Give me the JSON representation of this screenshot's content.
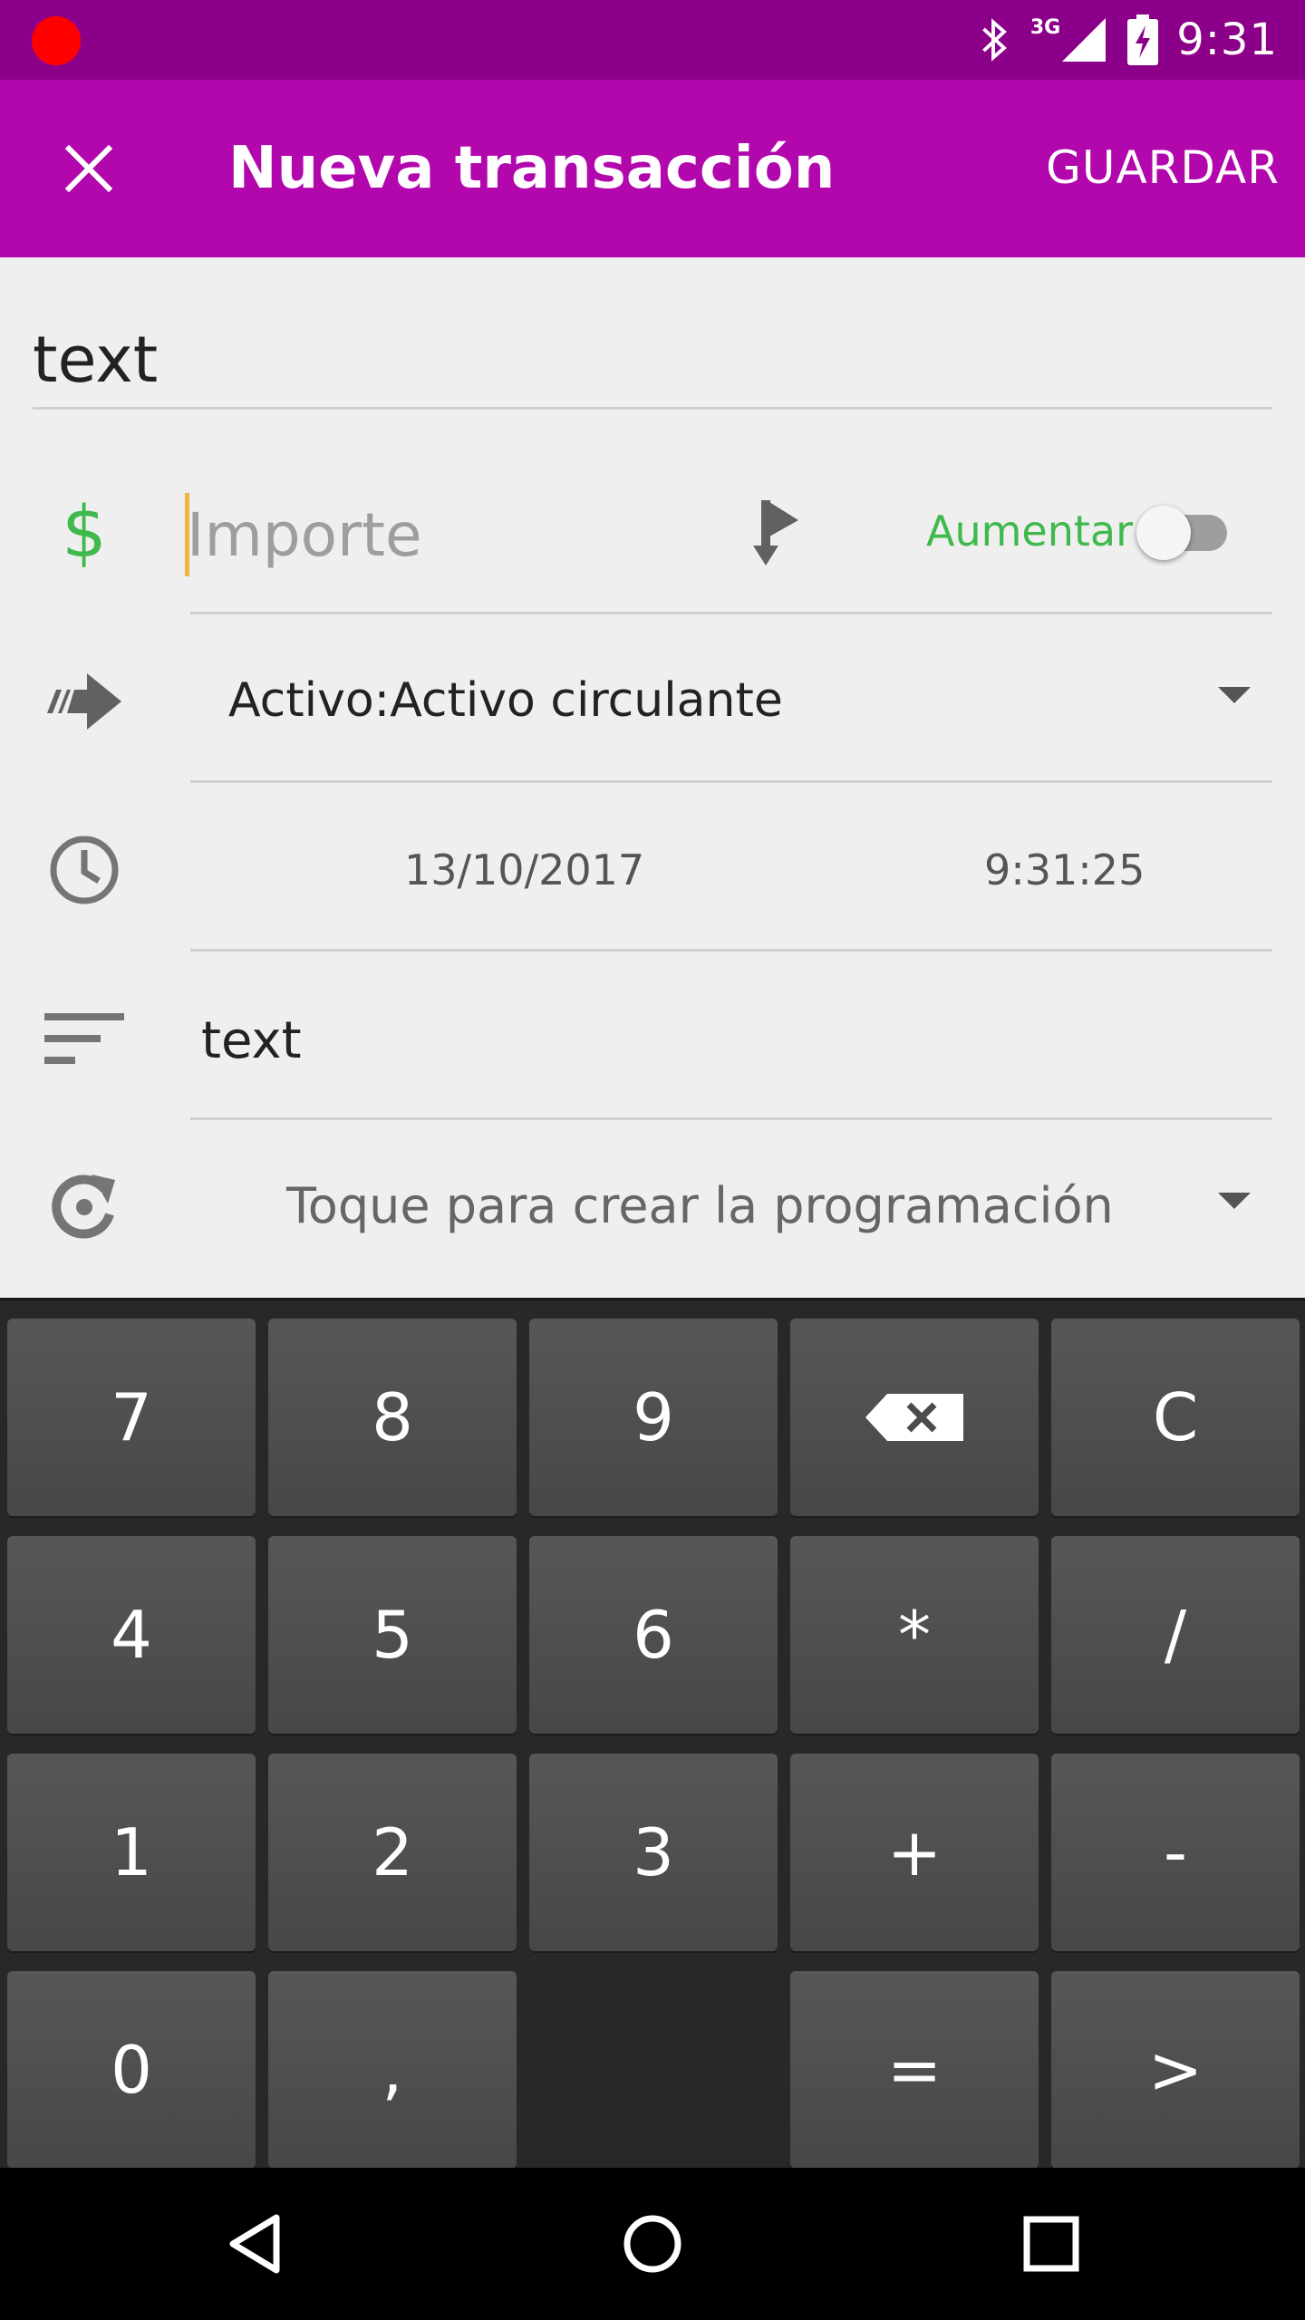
{
  "status_bar": {
    "time": "9:31",
    "network": "3G"
  },
  "app_bar": {
    "title": "Nueva transacción",
    "save_label": "GUARDAR"
  },
  "form": {
    "description_value": "text",
    "amount_placeholder": "Importe",
    "currency_symbol": "$",
    "increase_label": "Aumentar",
    "increase_on": false,
    "account": "Activo:Activo circulante",
    "date": "13/10/2017",
    "time": "9:31:25",
    "notes_value": "text",
    "recurrence": "Toque para crear la programación"
  },
  "keypad": {
    "keys": [
      [
        "7",
        "8",
        "9",
        "backspace",
        "C"
      ],
      [
        "4",
        "5",
        "6",
        "*",
        "/"
      ],
      [
        "1",
        "2",
        "3",
        "+",
        "-"
      ],
      [
        "0",
        ",",
        "",
        "=",
        ">"
      ]
    ]
  },
  "colors": {
    "app_bar": "#b107ad",
    "status_bar": "#8c0089",
    "accent_green": "#3fb94b",
    "keypad_key": "#4f4f4f"
  }
}
